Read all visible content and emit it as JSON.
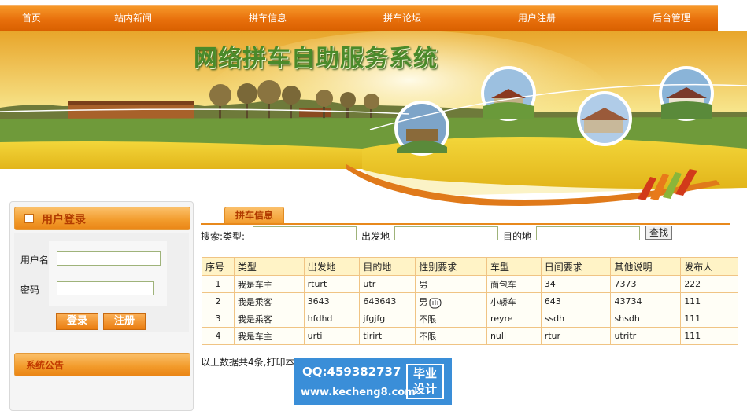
{
  "nav": {
    "items": [
      "首页",
      "站内新闻",
      "拼车信息",
      "拼车论坛",
      "用户注册",
      "后台管理"
    ]
  },
  "banner": {
    "title": "网络拼车自助服务系统"
  },
  "login": {
    "title": "用户登录",
    "username_label": "用户名",
    "password_label": "密码",
    "username_value": "",
    "password_value": "",
    "login_button": "登录",
    "register_button": "注册"
  },
  "announcement": {
    "title": "系统公告"
  },
  "main": {
    "tab_label": "拼车信息",
    "search": {
      "type_label": "搜索:类型:",
      "from_label": "出发地",
      "to_label": "目的地",
      "type_value": "",
      "from_value": "",
      "to_value": "",
      "button": "查找"
    },
    "table": {
      "columns": [
        "序号",
        "类型",
        "出发地",
        "目的地",
        "性别要求",
        "车型",
        "日间要求",
        "其他说明",
        "发布人"
      ],
      "rows": [
        [
          "1",
          "我是车主",
          "rturt",
          "utr",
          "男",
          "面包车",
          "34",
          "7373",
          "222"
        ],
        [
          "2",
          "我是乘客",
          "3643",
          "643643",
          "男",
          "小轿车",
          "643",
          "43734",
          "111"
        ],
        [
          "3",
          "我是乘客",
          "hfdhd",
          "jfgjfg",
          "不限",
          "reyre",
          "ssdh",
          "shsdh",
          "111"
        ],
        [
          "4",
          "我是车主",
          "urti",
          "tirirt",
          "不限",
          "null",
          "rtur",
          "utritr",
          "111"
        ]
      ]
    },
    "footer_text": "以上数据共4条,打印本页"
  },
  "watermark": {
    "qq": "QQ:459382737",
    "url": "www.kecheng8.com",
    "badge_line1": "毕业",
    "badge_line2": "设计"
  },
  "colors": {
    "nav": "#e8700c",
    "accent": "#f29a2a",
    "title_red": "#b23b00",
    "table_border": "#f0c484"
  }
}
